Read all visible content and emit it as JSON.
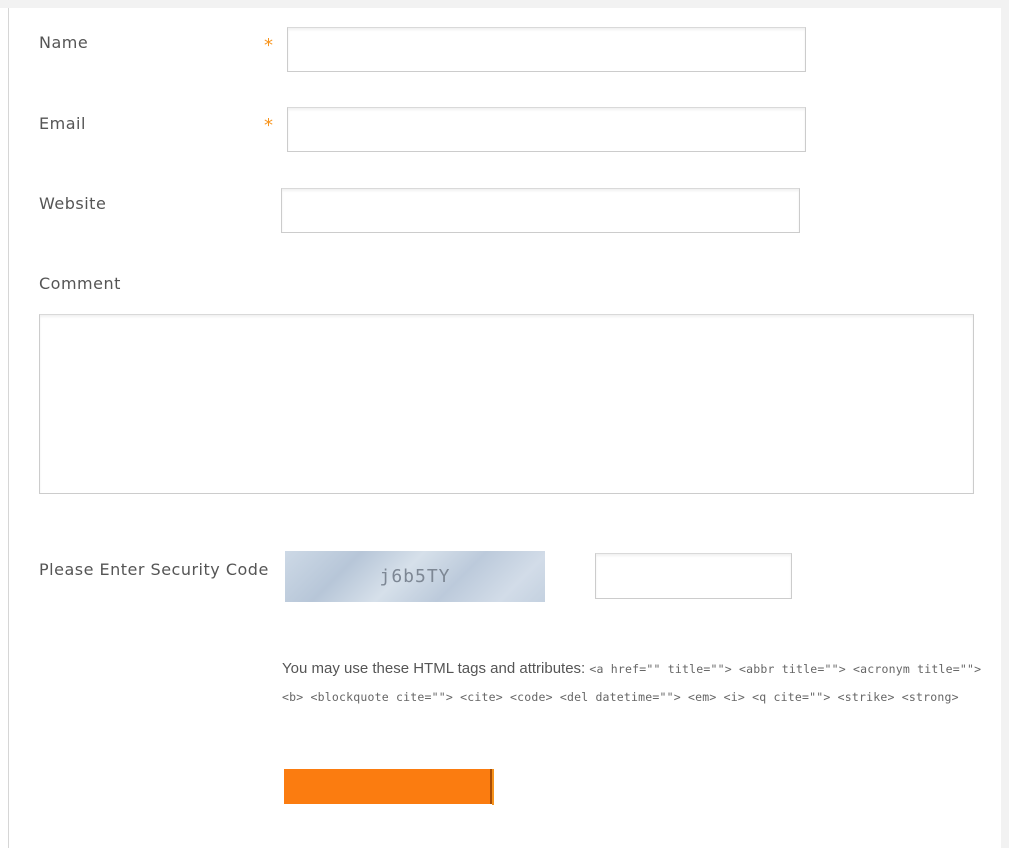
{
  "form": {
    "name": {
      "label": "Name",
      "required_marker": "*",
      "value": ""
    },
    "email": {
      "label": "Email",
      "required_marker": "*",
      "value": ""
    },
    "website": {
      "label": "Website",
      "value": ""
    },
    "comment": {
      "label": "Comment",
      "value": ""
    },
    "security": {
      "label": "Please Enter Security Code",
      "captcha_text": "j6b5TY",
      "value": ""
    },
    "allowed_tags": {
      "intro": "You may use these HTML tags and attributes:",
      "tags": "<a href=\"\" title=\"\"> <abbr title=\"\"> <acronym title=\"\"> <b> <blockquote cite=\"\"> <cite> <code> <del datetime=\"\"> <em> <i> <q cite=\"\"> <strike> <strong>"
    },
    "submit": {
      "label": "",
      "color": "#fb7c10"
    }
  },
  "colors": {
    "required": "#f7941d",
    "label_text": "#555555",
    "field_border": "#cccccc"
  }
}
